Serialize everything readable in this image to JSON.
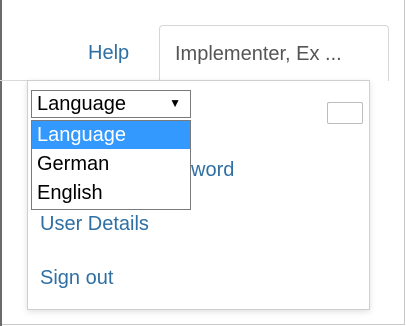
{
  "nav": {
    "help_label": "Help",
    "user_tab_label": "Implementer, Ex ..."
  },
  "language_select": {
    "selected": "Language",
    "options": [
      "Language",
      "German",
      "English"
    ],
    "highlighted_index": 0
  },
  "menu": {
    "change_password_label": "sword",
    "user_details_label": "User Details",
    "sign_out_label": "Sign out"
  },
  "icons": {
    "dropdown_arrow": "chevron-down-icon"
  },
  "colors": {
    "link": "#2f6fa3",
    "selection_highlight": "#3399ff"
  }
}
